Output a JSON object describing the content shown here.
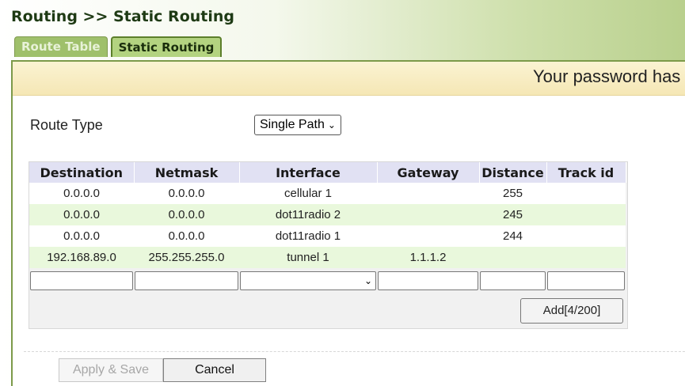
{
  "breadcrumb": "Routing >> Static Routing",
  "tabs": [
    {
      "label": "Route Table",
      "active": false
    },
    {
      "label": "Static Routing",
      "active": true
    }
  ],
  "notice": "Your password has",
  "route_type": {
    "label": "Route Type",
    "value": "Single Path"
  },
  "table": {
    "headers": [
      "Destination",
      "Netmask",
      "Interface",
      "Gateway",
      "Distance",
      "Track id"
    ],
    "rows": [
      [
        "0.0.0.0",
        "0.0.0.0",
        "cellular 1",
        "",
        "255",
        ""
      ],
      [
        "0.0.0.0",
        "0.0.0.0",
        "dot11radio 2",
        "",
        "245",
        ""
      ],
      [
        "0.0.0.0",
        "0.0.0.0",
        "dot11radio 1",
        "",
        "244",
        ""
      ],
      [
        "192.168.89.0",
        "255.255.255.0",
        "tunnel 1",
        "1.1.1.2",
        "",
        ""
      ]
    ]
  },
  "add_button": "Add[4/200]",
  "apply_button": "Apply & Save",
  "cancel_button": "Cancel",
  "colors": {
    "accent": "#7c9a4a",
    "header_bg": "#e1e1f3",
    "row_alt": "#e9f8dc"
  }
}
